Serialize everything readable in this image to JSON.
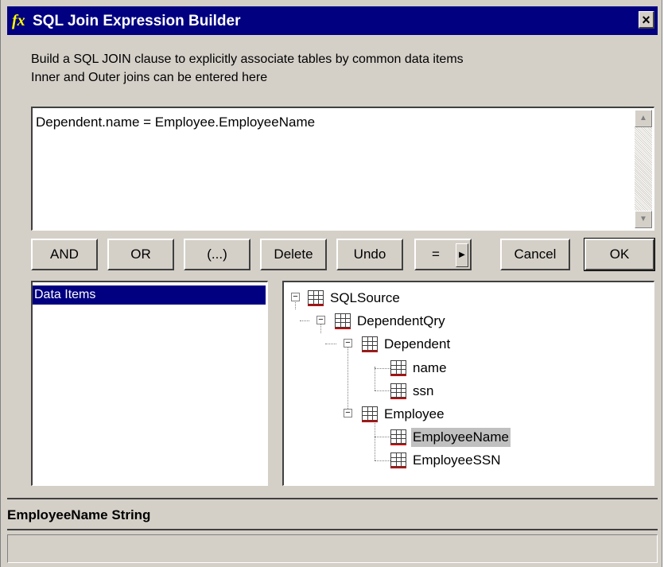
{
  "window": {
    "title": "SQL Join Expression Builder",
    "title_icon": "fx",
    "close_glyph": "×"
  },
  "description": {
    "line1": "Build a SQL JOIN clause to explicitly associate tables by common data items",
    "line2": "Inner and Outer joins can be entered here"
  },
  "expression": {
    "value": "Dependent.name = Employee.EmployeeName"
  },
  "buttons": {
    "and": "AND",
    "or": "OR",
    "paren": "(...)",
    "delete": "Delete",
    "undo": "Undo",
    "operator": "=",
    "cancel": "Cancel",
    "ok": "OK"
  },
  "data_items": {
    "selected": "Data Items"
  },
  "tree": {
    "nodes": [
      "SQLSource",
      "DependentQry",
      "Dependent",
      "name",
      "ssn",
      "Employee",
      "EmployeeName",
      "EmployeeSSN"
    ],
    "selected": "EmployeeName"
  },
  "status": {
    "text": "EmployeeName String"
  },
  "colors": {
    "titlebar": "#000080",
    "face": "#d4d0c8",
    "selection": "#000080",
    "key_underline": "#c00000"
  }
}
